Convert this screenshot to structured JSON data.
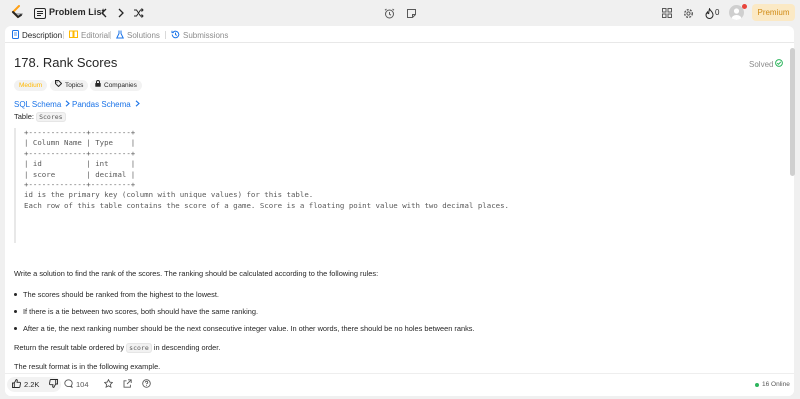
{
  "topbar": {
    "problem_list": "Problem List",
    "streak": "0",
    "premium": "Premium"
  },
  "tabs": [
    {
      "label": "Description",
      "icon": "document-icon"
    },
    {
      "label": "Editorial",
      "icon": "book-icon"
    },
    {
      "label": "Solutions",
      "icon": "flask-icon"
    },
    {
      "label": "Submissions",
      "icon": "history-icon"
    }
  ],
  "problem": {
    "title": "178. Rank Scores",
    "status": "Solved",
    "difficulty": "Medium",
    "topics": "Topics",
    "companies": "Companies",
    "sql_schema": "SQL Schema",
    "pandas_schema": "Pandas Schema",
    "table_prefix": "Table:",
    "table_name": "Scores",
    "schema_lines": [
      "+-------------+---------+",
      "| Column Name | Type    |",
      "+-------------+---------+",
      "| id          | int     |",
      "| score       | decimal |",
      "+-------------+---------+",
      "id is the primary key (column with unique values) for this table.",
      "Each row of this table contains the score of a game. Score is a floating point value with two decimal places."
    ],
    "intro": "Write a solution to find the rank of the scores. The ranking should be calculated according to the following rules:",
    "rules": [
      "The scores should be ranked from the highest to the lowest.",
      "If there is a tie between two scores, both should have the same ranking.",
      "After a tie, the next ranking number should be the next consecutive integer value. In other words, there should be no holes between ranks."
    ],
    "return_before": "Return the result table ordered by",
    "return_code": "score",
    "return_after": "in descending order.",
    "format": "The result format is in the following example."
  },
  "bottom": {
    "likes": "2.2K",
    "comments": "104",
    "online": "16 Online"
  },
  "colors": {
    "accent_premium": "#d08a14",
    "difficulty_medium": "#ffb800",
    "link": "#1a73e8",
    "online": "#2db55d",
    "solved": "#2db55d"
  }
}
